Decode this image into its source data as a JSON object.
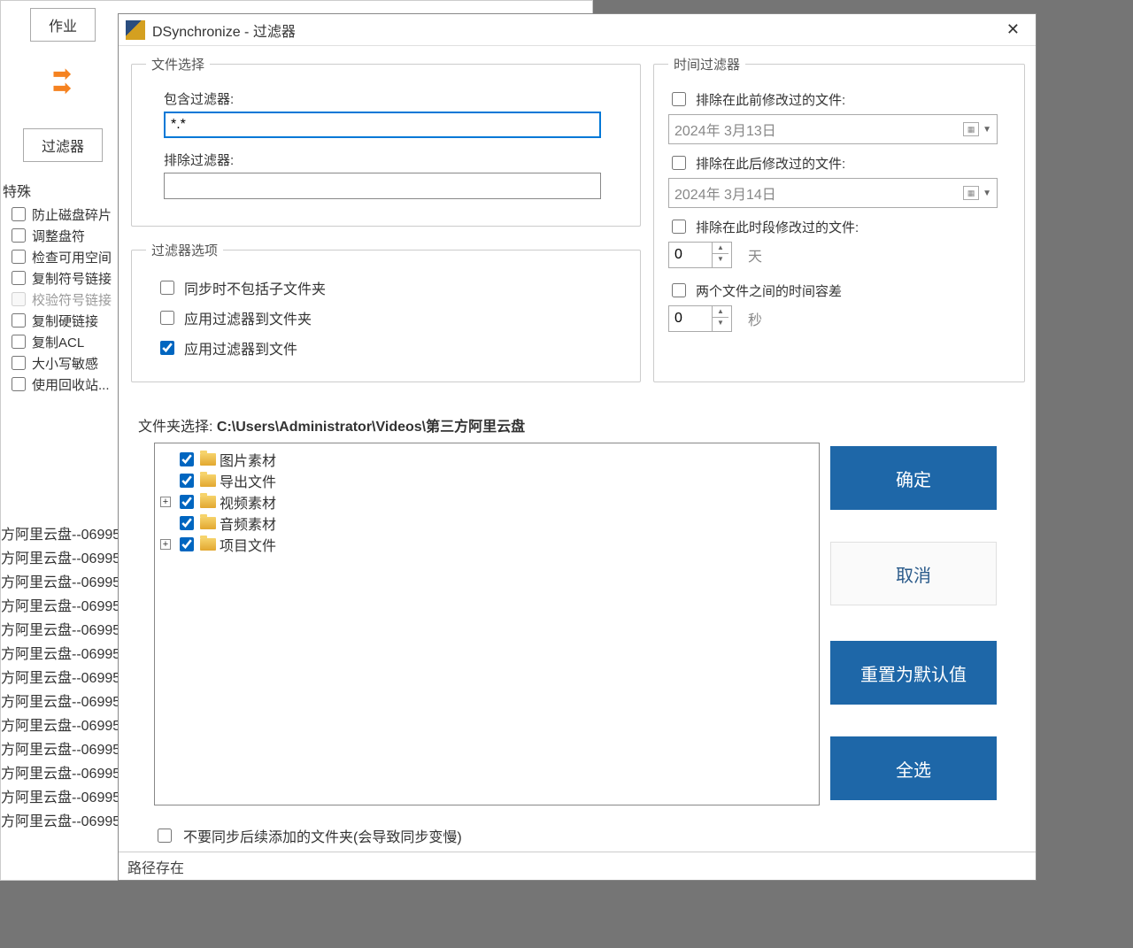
{
  "bg": {
    "btn_job": "作业",
    "btn_filter": "过滤器",
    "special_group": "特殊",
    "checks": [
      "防止磁盘碎片",
      "调整盘符",
      "检查可用空间",
      "复制符号链接",
      "校验符号链接",
      "复制硬链接",
      "复制ACL",
      "大小写敏感",
      "使用回收站..."
    ],
    "log_line": "方阿里云盘--06995"
  },
  "dialog": {
    "title": "DSynchronize - 过滤器",
    "file_select": {
      "legend": "文件选择",
      "include_label": "包含过滤器:",
      "include_value": "*.*",
      "exclude_label": "排除过滤器:",
      "exclude_value": ""
    },
    "filter_opts": {
      "legend": "过滤器选项",
      "opt1": "同步时不包括子文件夹",
      "opt2": "应用过滤器到文件夹",
      "opt3": "应用过滤器到文件"
    },
    "time": {
      "legend": "时间过滤器",
      "before_label": "排除在此前修改过的文件:",
      "before_date": "2024年  3月13日",
      "after_label": "排除在此后修改过的文件:",
      "after_date": "2024年  3月14日",
      "period_label": "排除在此时段修改过的文件:",
      "days_value": "0",
      "days_unit": "天",
      "tolerance_label": "两个文件之间的时间容差",
      "tol_value": "0",
      "tol_unit": "秒"
    },
    "folder_label": "文件夹选择: ",
    "folder_path": "C:\\Users\\Administrator\\Videos\\第三方阿里云盘",
    "tree": [
      {
        "expand": false,
        "label": "图片素材"
      },
      {
        "expand": false,
        "label": "导出文件"
      },
      {
        "expand": true,
        "label": "视频素材"
      },
      {
        "expand": false,
        "label": "音频素材"
      },
      {
        "expand": true,
        "label": "项目文件"
      }
    ],
    "post_add_label": "不要同步后续添加的文件夹(会导致同步变慢)",
    "buttons": {
      "ok": "确定",
      "cancel": "取消",
      "reset": "重置为默认值",
      "select_all": "全选"
    },
    "status": "路径存在"
  }
}
